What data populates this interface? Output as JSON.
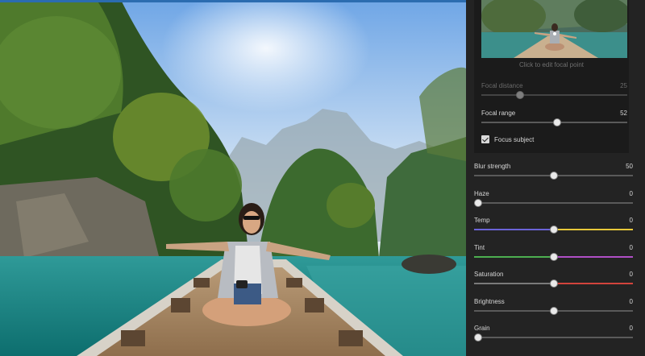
{
  "focal_panel": {
    "thumbnail_caption": "Click to edit focal point",
    "focal_distance": {
      "label": "Focal distance",
      "value": "25",
      "fraction": 0.25
    },
    "focal_range": {
      "label": "Focal range",
      "value": "52",
      "fraction": 0.52
    },
    "focus_subject": {
      "label": "Focus subject",
      "checked": true
    }
  },
  "adjustments": [
    {
      "label": "Blur strength",
      "value": "50",
      "fraction": 0.5,
      "track": "plain"
    },
    {
      "label": "Haze",
      "value": "0",
      "fraction": 0.0,
      "track": "plain"
    },
    {
      "label": "Temp",
      "value": "0",
      "fraction": 0.5,
      "track": "temp"
    },
    {
      "label": "Tint",
      "value": "0",
      "fraction": 0.5,
      "track": "tint"
    },
    {
      "label": "Saturation",
      "value": "0",
      "fraction": 0.5,
      "track": "saturation"
    },
    {
      "label": "Brightness",
      "value": "0",
      "fraction": 0.5,
      "track": "plain"
    },
    {
      "label": "Grain",
      "value": "0",
      "fraction": 0.0,
      "track": "plain"
    }
  ],
  "colors": {
    "panel_bg": "#232323",
    "card_bg": "#1b1b1b",
    "temp_track": "#6b63d8",
    "temp_track_end": "#e8c83a",
    "tint_track": "#4caf50",
    "tint_track_end": "#b04fc6",
    "saturation_track_end": "#d2443c"
  }
}
